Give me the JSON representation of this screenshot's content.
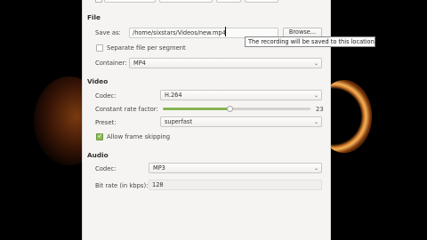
{
  "file": {
    "section_title": "File",
    "save_as_label": "Save as:",
    "save_as_value": "/home/sixstars/Videos/new.mp4",
    "browse_label": "Browse...",
    "separate_file_label": "Separate file per segment",
    "separate_file_checked": false,
    "container_label": "Container:",
    "container_value": "MP4",
    "tooltip": "The recording will be saved to this location."
  },
  "video": {
    "section_title": "Video",
    "codec_label": "Codec:",
    "codec_value": "H.264",
    "crf_label": "Constant rate factor:",
    "crf_value": "23",
    "preset_label": "Preset:",
    "preset_value": "superfast",
    "frame_skip_label": "Allow frame skipping",
    "frame_skip_checked": true
  },
  "audio": {
    "section_title": "Audio",
    "codec_label": "Codec:",
    "codec_value": "MP3",
    "bitrate_label": "Bit rate (in kbps):",
    "bitrate_value": "128"
  },
  "icons": {
    "dropdown": "chevron-down-icon",
    "check": "checkmark-icon"
  }
}
